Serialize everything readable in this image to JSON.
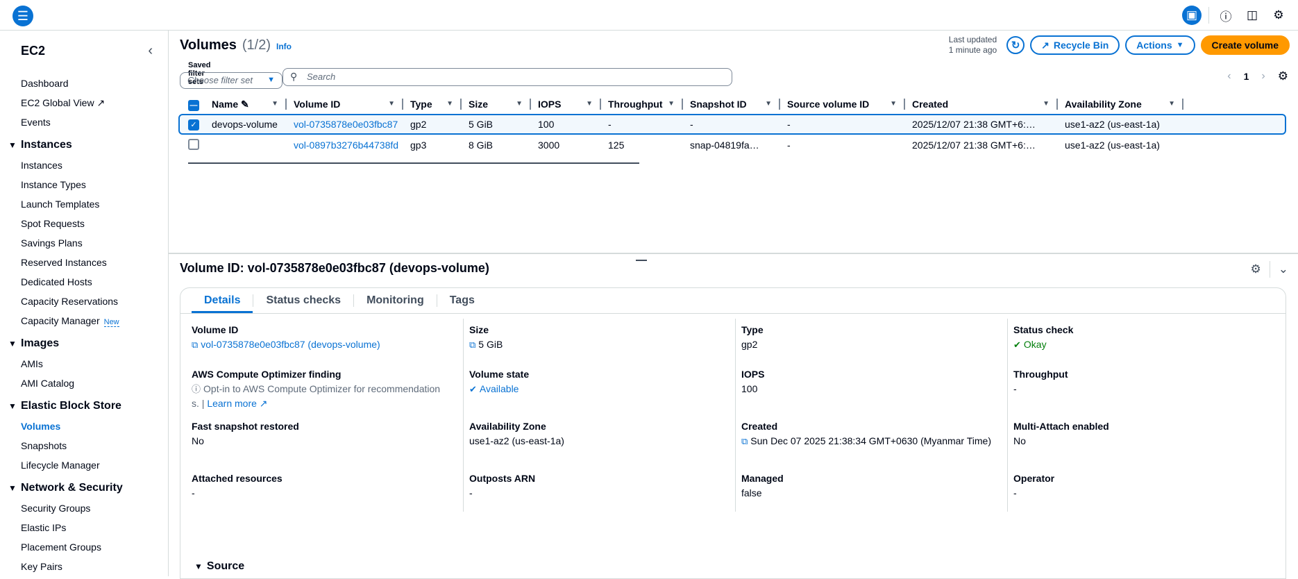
{
  "topbar": {
    "icons": [
      "menu-icon",
      "panel-icon",
      "info-icon",
      "feedback-icon",
      "settings-icon"
    ]
  },
  "sidebar": {
    "title": "EC2",
    "top_items": [
      {
        "label": "Dashboard"
      },
      {
        "label": "EC2 Global View"
      },
      {
        "label": "Events"
      }
    ],
    "sections": [
      {
        "label": "Instances",
        "items": [
          "Instances",
          "Instance Types",
          "Launch Templates",
          "Spot Requests",
          "Savings Plans",
          "Reserved Instances",
          "Dedicated Hosts",
          "Capacity Reservations",
          "Capacity Manager"
        ]
      },
      {
        "label": "Images",
        "items": [
          "AMIs",
          "AMI Catalog"
        ]
      },
      {
        "label": "Elastic Block Store",
        "items": [
          "Volumes",
          "Snapshots",
          "Lifecycle Manager"
        ]
      },
      {
        "label": "Network & Security",
        "items": [
          "Security Groups",
          "Elastic IPs",
          "Placement Groups",
          "Key Pairs"
        ]
      }
    ],
    "new_badge": "New"
  },
  "header": {
    "title": "Volumes",
    "count": "(1/2)",
    "info": "Info",
    "last_updated_line1": "Last updated",
    "last_updated_line2": "1 minute ago",
    "recycle_bin": "Recycle Bin",
    "actions": "Actions",
    "create_volume": "Create volume"
  },
  "filters": {
    "saved_label": "Saved filter sets",
    "saved_placeholder": "Choose filter set",
    "search_placeholder": "Search",
    "page": "1"
  },
  "table": {
    "columns": [
      "Name",
      "Volume ID",
      "Type",
      "Size",
      "IOPS",
      "Throughput",
      "Snapshot ID",
      "Source volume ID",
      "Created",
      "Availability Zone"
    ],
    "rows": [
      {
        "name": "devops-volume",
        "volume_id": "vol-0735878e0e03fbc87",
        "type": "gp2",
        "size": "5 GiB",
        "iops": "100",
        "throughput": "-",
        "snapshot": "-",
        "source": "-",
        "created": "2025/12/07 21:38 GMT+6:…",
        "az": "use1-az2 (us-east-1a)",
        "selected": true
      },
      {
        "name": "",
        "volume_id": "vol-0897b3276b44738fd",
        "type": "gp3",
        "size": "8 GiB",
        "iops": "3000",
        "throughput": "125",
        "snapshot": "snap-04819fa…",
        "source": "-",
        "created": "2025/12/07 21:38 GMT+6:…",
        "az": "use1-az2 (us-east-1a)",
        "selected": false
      }
    ]
  },
  "detail": {
    "title": "Volume ID: vol-0735878e0e03fbc87 (devops-volume)",
    "tabs": [
      "Details",
      "Status checks",
      "Monitoring",
      "Tags"
    ],
    "fields": {
      "volume_id_k": "Volume ID",
      "volume_id_v": "vol-0735878e0e03fbc87 (devops-volume)",
      "size_k": "Size",
      "size_v": "5 GiB",
      "type_k": "Type",
      "type_v": "gp2",
      "status_k": "Status check",
      "status_v": "Okay",
      "optimizer_k": "AWS Compute Optimizer finding",
      "optimizer_v": "Opt-in to AWS Compute Optimizer for recommendation",
      "optimizer_v2": "s. |",
      "learn_more": "Learn more",
      "state_k": "Volume state",
      "state_v": "Available",
      "iops_k": "IOPS",
      "iops_v": "100",
      "throughput_k": "Throughput",
      "throughput_v": "-",
      "fast_k": "Fast snapshot restored",
      "fast_v": "No",
      "az_k": "Availability Zone",
      "az_v": "use1-az2 (us-east-1a)",
      "created_k": "Created",
      "created_v": "Sun Dec 07 2025 21:38:34 GMT+0630 (Myanmar Time)",
      "multi_k": "Multi-Attach enabled",
      "multi_v": "No",
      "attached_k": "Attached resources",
      "attached_v": "-",
      "outposts_k": "Outposts ARN",
      "outposts_v": "-",
      "managed_k": "Managed",
      "managed_v": "false",
      "operator_k": "Operator",
      "operator_v": "-"
    },
    "source_label": "Source"
  },
  "colors": {
    "accent": "#0972d3",
    "primary_button": "#ff9900",
    "success": "#037f0c"
  }
}
